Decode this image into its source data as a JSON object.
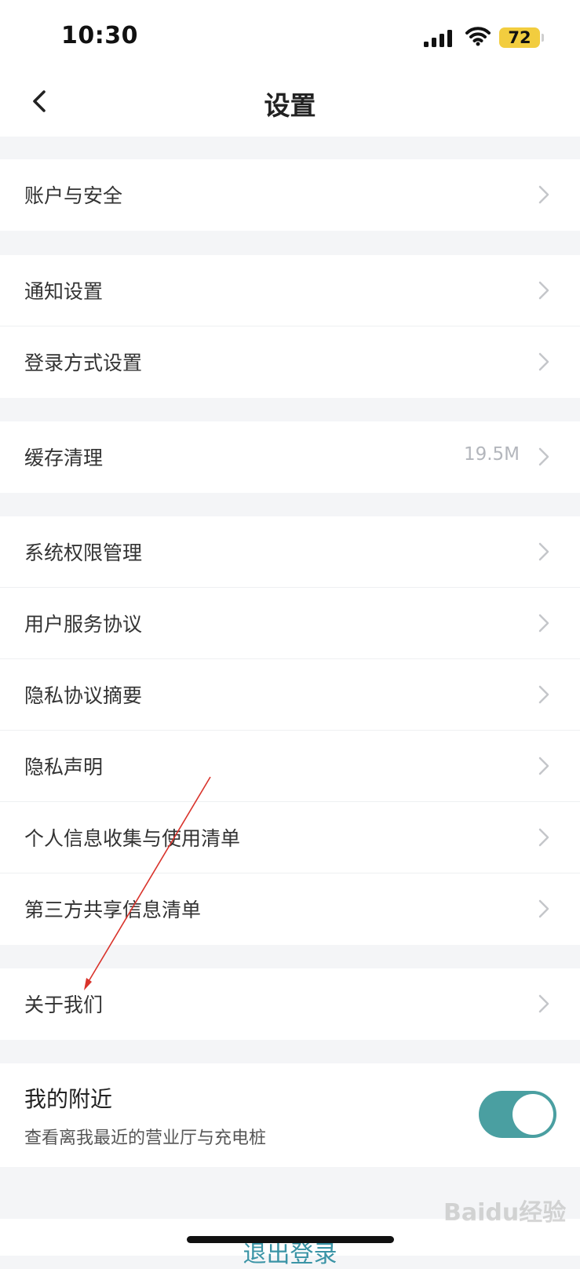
{
  "status_bar": {
    "time": "10:30",
    "battery": "72"
  },
  "header": {
    "title": "设置"
  },
  "menu": {
    "account_security": "账户与安全",
    "notification": "通知设置",
    "login_method": "登录方式设置",
    "cache": {
      "label": "缓存清理",
      "value": "19.5M"
    },
    "system_permission": "系统权限管理",
    "user_agreement": "用户服务协议",
    "privacy_summary": "隐私协议摘要",
    "privacy_statement": "隐私声明",
    "personal_info": "个人信息收集与使用清单",
    "third_party": "第三方共享信息清单",
    "about_us": "关于我们"
  },
  "nearby": {
    "title": "我的附近",
    "subtitle": "查看离我最近的营业厅与充电桩",
    "enabled": true
  },
  "logout_label": "退出登录",
  "watermark": "Baidu经验",
  "colors": {
    "accent": "#4a9fa1",
    "logout": "#3a94a6",
    "annotation": "#d9332b",
    "background": "#f4f5f7"
  }
}
